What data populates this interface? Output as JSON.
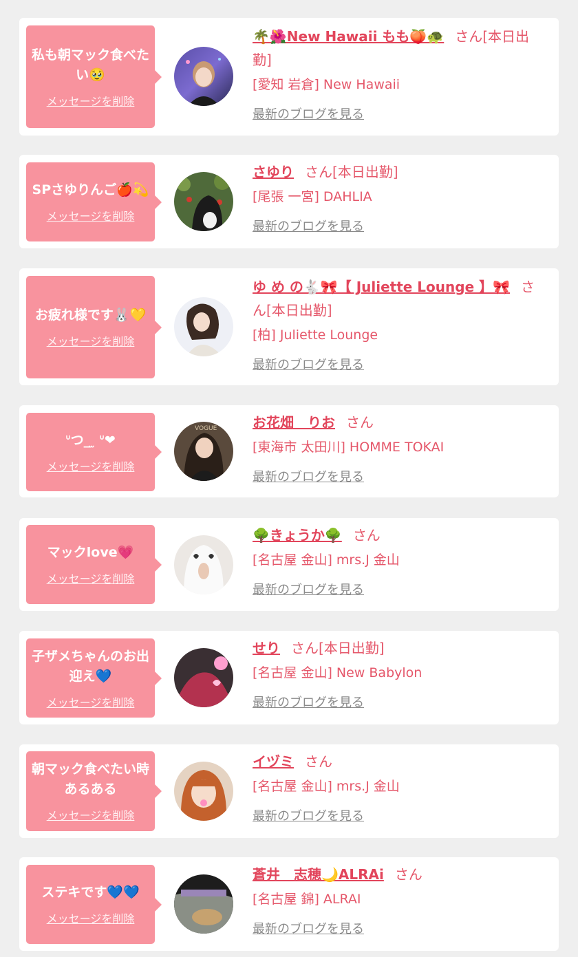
{
  "delete_label": "メッセージを削除",
  "blog_label": "最新のブログを見る",
  "colors": {
    "bubble": "#f8939e",
    "name": "#e2455b",
    "text": "#e5576a",
    "link_gray": "#8a8a8a",
    "background": "#efefef"
  },
  "items": [
    {
      "message": "私も朝マック食べたい🥹",
      "name": "🌴🌺New Hawaii もも🍑🐢",
      "suffix": "さん[本日出勤]",
      "shop": "[愛知 岩倉] New Hawaii"
    },
    {
      "message": "SPさゆりんご🍎💫",
      "name": "さゆり",
      "suffix": "さん[本日出勤]",
      "shop": "[尾張 一宮] DAHLIA"
    },
    {
      "message": "お疲れ様です🐰💛",
      "name": "ゆ め の🐇🎀【 Juliette Lounge 】🎀",
      "suffix": "さん[本日出勤]",
      "shop": "[柏] Juliette Lounge"
    },
    {
      "message": "ᐡつ_ ̫ ᐡ❤︎",
      "name": "お花畑　りお",
      "suffix": "さん",
      "shop": "[東海市 太田川] HOMME TOKAI"
    },
    {
      "message": "マックlove💗",
      "name": "🌳きょうか🌳",
      "suffix": "さん",
      "shop": "[名古屋 金山] mrs.J 金山"
    },
    {
      "message": "子ザメちゃんのお出迎え💙",
      "name": "せり",
      "suffix": "さん[本日出勤]",
      "shop": "[名古屋 金山] New Babylon"
    },
    {
      "message": "朝マック食べたい時あるある",
      "name": "イヅミ",
      "suffix": "さん",
      "shop": "[名古屋 金山] mrs.J 金山"
    },
    {
      "message": "ステキです💙💙",
      "name": "蒼井　志穂🌙ALRAi",
      "suffix": "さん",
      "shop": "[名古屋 錦] ALRAI"
    }
  ]
}
